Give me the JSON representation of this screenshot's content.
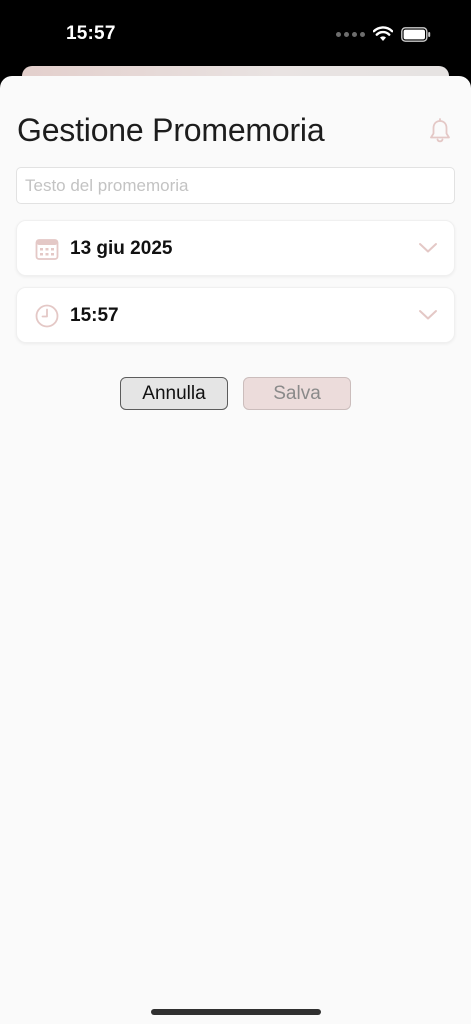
{
  "status_bar": {
    "time": "15:57"
  },
  "sheet": {
    "title": "Gestione Promemoria",
    "reminder_text": {
      "value": "",
      "placeholder": "Testo del promemoria"
    },
    "date_picker": {
      "value": "13 giu 2025",
      "icon": "calendar-icon"
    },
    "time_picker": {
      "value": "15:57",
      "icon": "clock-icon"
    },
    "buttons": {
      "cancel_label": "Annulla",
      "save_label": "Salva"
    }
  },
  "colors": {
    "accent_light": "#ecdcdb",
    "icon_tint": "#e4c8c6"
  }
}
